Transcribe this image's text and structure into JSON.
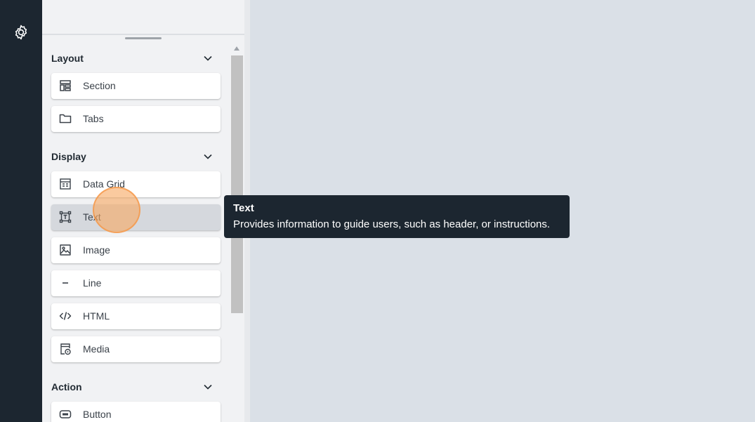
{
  "icons": {
    "settings": "gear-icon",
    "collapse": "chevron-down-icon"
  },
  "colors": {
    "rail": "#1c2630",
    "panel": "#f1f2f4",
    "canvas": "#dae0e7",
    "tooltip": "#1c2630",
    "click_marker": "#f7aa64"
  },
  "sections": {
    "layout": {
      "title": "Layout",
      "items": [
        {
          "label": "Section",
          "icon": "section-layout-icon"
        },
        {
          "label": "Tabs",
          "icon": "folder-icon"
        }
      ]
    },
    "display": {
      "title": "Display",
      "items": [
        {
          "label": "Data Grid",
          "icon": "data-grid-icon"
        },
        {
          "label": "Text",
          "icon": "text-frame-icon"
        },
        {
          "label": "Image",
          "icon": "image-icon"
        },
        {
          "label": "Line",
          "icon": "line-icon"
        },
        {
          "label": "HTML",
          "icon": "code-icon"
        },
        {
          "label": "Media",
          "icon": "media-icon"
        }
      ]
    },
    "action": {
      "title": "Action",
      "items": [
        {
          "label": "Button",
          "icon": "button-icon"
        }
      ]
    }
  },
  "tooltip": {
    "title": "Text",
    "body": "Provides information to guide users, such as header, or instructions."
  }
}
